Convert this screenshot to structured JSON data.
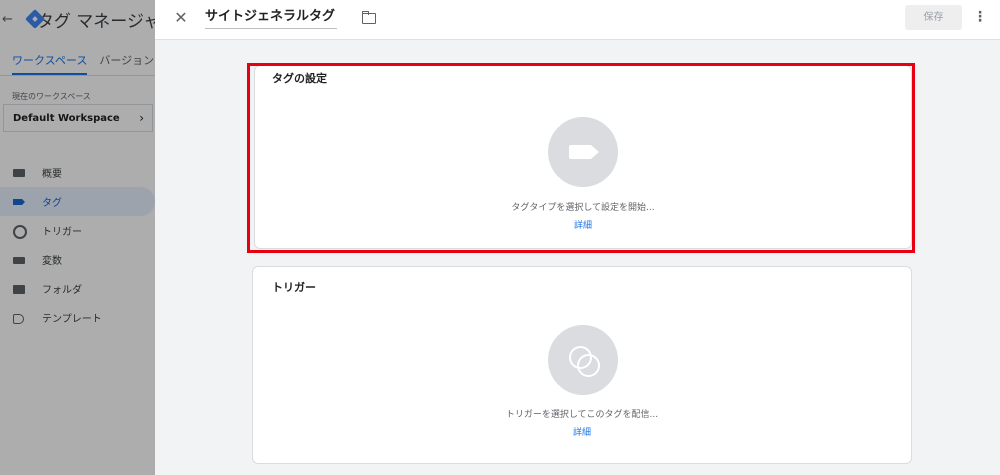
{
  "background": {
    "app_title": "タグ マネージャー",
    "tabs": [
      {
        "label": "ワークスペース"
      },
      {
        "label": "バージョン"
      }
    ],
    "workspace": {
      "label": "現在のワークスペース",
      "name": "Default Workspace"
    },
    "nav": [
      {
        "label": "概要",
        "icon": "overview-icon"
      },
      {
        "label": "タグ",
        "icon": "tag-icon"
      },
      {
        "label": "トリガー",
        "icon": "trigger-icon"
      },
      {
        "label": "変数",
        "icon": "variables-icon"
      },
      {
        "label": "フォルダ",
        "icon": "folder-icon"
      },
      {
        "label": "テンプレート",
        "icon": "template-icon"
      }
    ]
  },
  "editor": {
    "title": "サイトジェネラルタグ",
    "save_label": "保存",
    "tag_config": {
      "heading": "タグの設定",
      "hint": "タグタイプを選択して設定を開始...",
      "link": "詳細"
    },
    "trigger": {
      "heading": "トリガー",
      "hint": "トリガーを選択してこのタグを配信...",
      "link": "詳細"
    }
  },
  "colors": {
    "accent": "#1a73e8",
    "highlight": "#e60012",
    "panel_bg": "#f1f3f4"
  }
}
